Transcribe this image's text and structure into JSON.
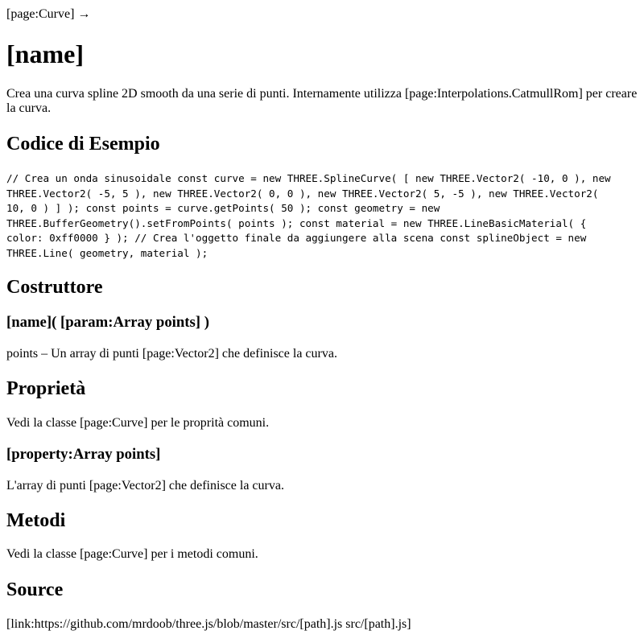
{
  "breadcrumb": "[page:Curve] →",
  "title": "[name]",
  "intro": "Crea una curva spline 2D smooth da una serie di punti. Internamente utilizza [page:Interpolations.CatmullRom] per creare la curva.",
  "example": {
    "heading": "Codice di Esempio",
    "code_lines": [
      "// Crea un onda sinusoidale const curve = new THREE.SplineCurve( [ new THREE.Vector2( -10, 0 ), new",
      "THREE.Vector2( -5, 5 ), new THREE.Vector2( 0, 0 ), new THREE.Vector2( 5, -5 ), new THREE.Vector2(",
      "10, 0 ) ] ); const points = curve.getPoints( 50 ); const geometry = new",
      "THREE.BufferGeometry().setFromPoints( points ); const material = new THREE.LineBasicMaterial( {",
      "color: 0xff0000 } ); // Crea l'oggetto finale da aggiungere alla scena const splineObject = new",
      "THREE.Line( geometry, material );"
    ]
  },
  "constructor": {
    "heading": "Costruttore",
    "signature": "[name]( [param:Array points] )",
    "description": "points – Un array di punti [page:Vector2] che definisce la curva."
  },
  "properties": {
    "heading": "Proprietà",
    "description": "Vedi la classe [page:Curve] per le proprità comuni.",
    "points_heading": "[property:Array points]",
    "points_description": "L'array di punti [page:Vector2] che definisce la curva."
  },
  "methods": {
    "heading": "Metodi",
    "description": "Vedi la classe [page:Curve] per i metodi comuni."
  },
  "source": {
    "heading": "Source",
    "link": "[link:https://github.com/mrdoob/three.js/blob/master/src/[path].js src/[path].js]"
  }
}
